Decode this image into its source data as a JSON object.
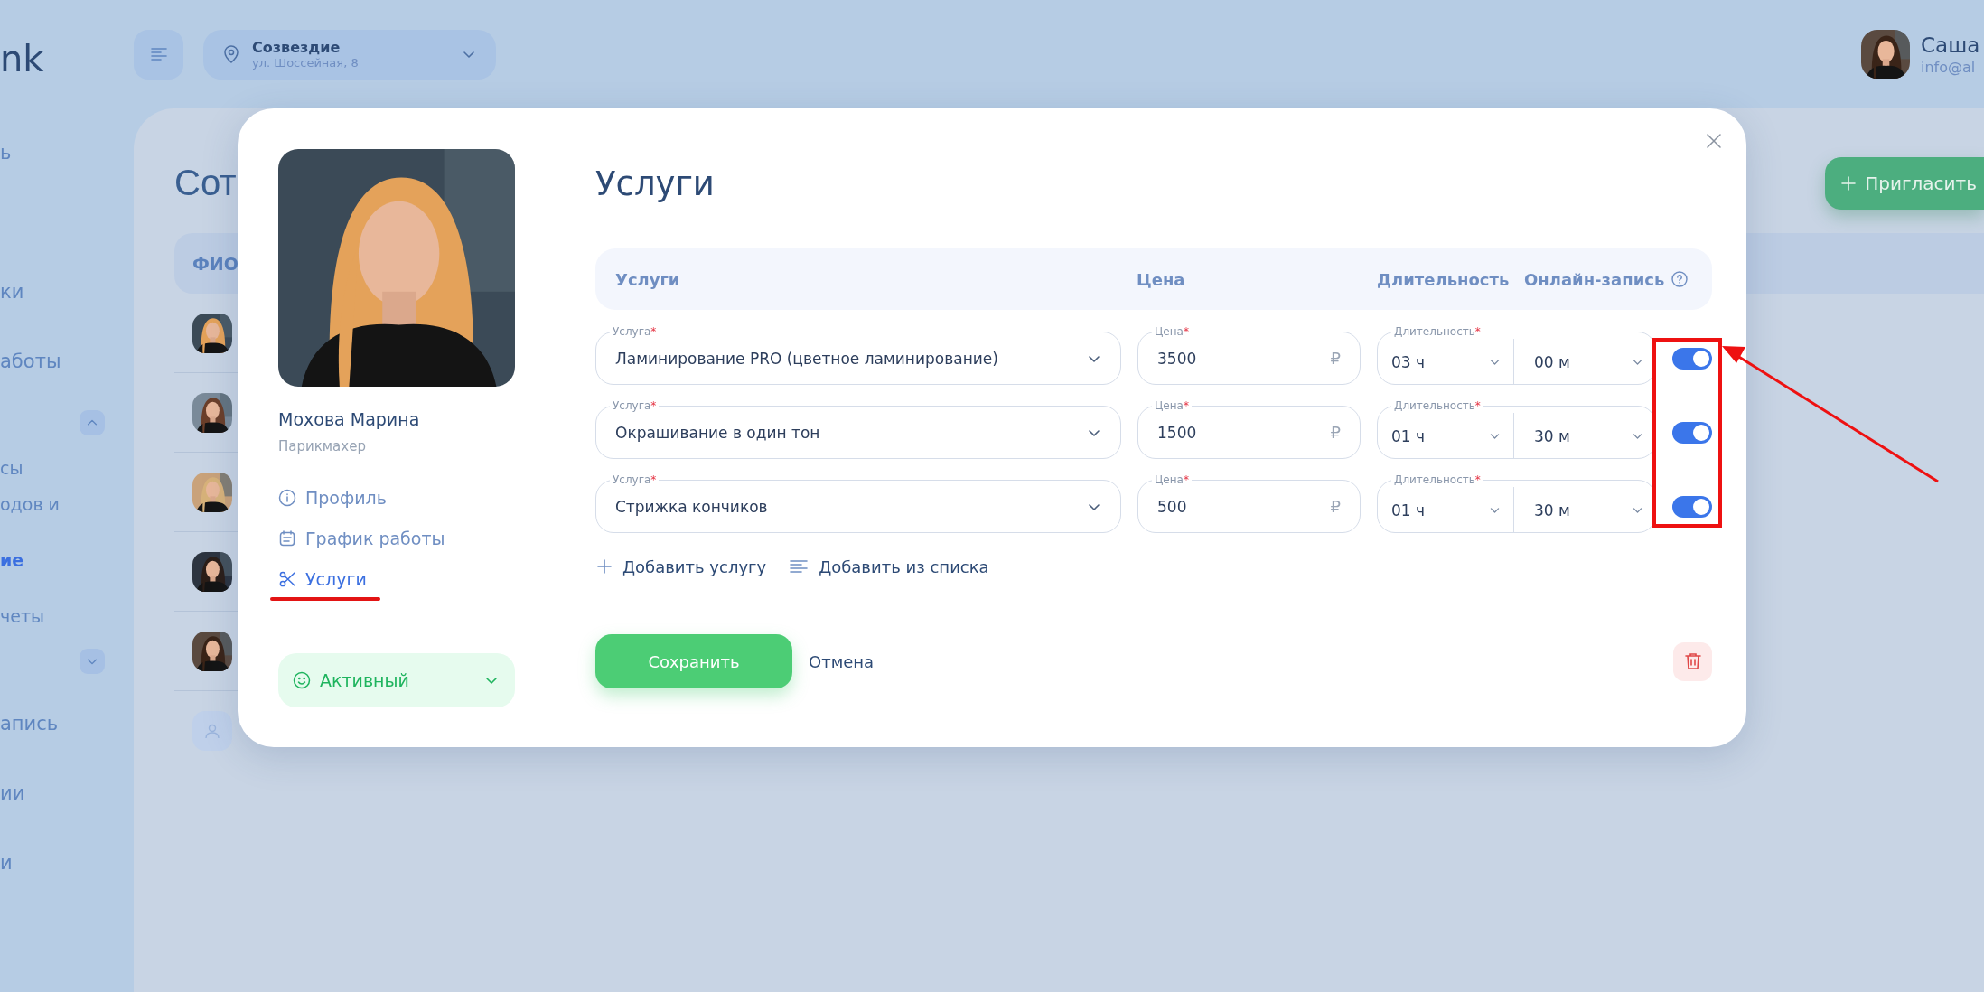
{
  "sidebar": {
    "logo": "nk",
    "items": [
      {
        "kind": "link",
        "label": "ь",
        "selected": false
      },
      {
        "kind": "link",
        "label": "ки",
        "selected": false
      },
      {
        "kind": "link",
        "label": "аботы",
        "selected": false
      },
      {
        "kind": "group",
        "expanded": true
      },
      {
        "kind": "sublink",
        "label": "сы",
        "selected": false
      },
      {
        "kind": "sublink",
        "label": "одов и",
        "selected": false
      },
      {
        "kind": "sublink",
        "label": "ие",
        "selected": true
      },
      {
        "kind": "sublink",
        "label": "четы",
        "selected": false
      },
      {
        "kind": "group",
        "expanded": false
      },
      {
        "kind": "link",
        "label": "апись",
        "selected": false
      },
      {
        "kind": "link",
        "label": "ии",
        "selected": false
      },
      {
        "kind": "link",
        "label": "и",
        "selected": false
      }
    ]
  },
  "header": {
    "location": {
      "name": "Созвездие",
      "address": "ул. Шоссейная, 8"
    },
    "user": {
      "name": "Саша",
      "email": "info@al"
    }
  },
  "page": {
    "title": "Сот",
    "invite_button": "Пригласить",
    "table": {
      "columns": [
        "ФИО"
      ],
      "rows": [
        {
          "kind": "picture"
        },
        {
          "kind": "picture"
        },
        {
          "kind": "picture"
        },
        {
          "kind": "picture"
        },
        {
          "kind": "picture"
        },
        {
          "kind": "placeholder"
        }
      ]
    }
  },
  "modal": {
    "employee": {
      "name": "Мохова Марина",
      "role": "Парикмахер"
    },
    "nav": [
      {
        "kind": "info",
        "label": "Профиль",
        "selected": false
      },
      {
        "kind": "calendar",
        "label": "График работы",
        "selected": false
      },
      {
        "kind": "scissors",
        "label": "Услуги",
        "selected": true
      }
    ],
    "status": {
      "label": "Активный"
    },
    "title": "Услуги",
    "columns": [
      "Услуги",
      "Цена",
      "Длительность",
      "Онлайн-запись"
    ],
    "services": [
      {
        "service": {
          "label": "Услуга",
          "mark": "*",
          "value": "Ламинирование PRO (цветное ламинирование)"
        },
        "price": {
          "label": "Цена",
          "mark": "*",
          "value": "3500",
          "suffix": "₽"
        },
        "duration": {
          "label": "Длительность",
          "mark": "*",
          "hours": "03 ч",
          "minutes": "00 м"
        },
        "online": true
      },
      {
        "service": {
          "label": "Услуга",
          "mark": "*",
          "value": "Окрашивание в один тон"
        },
        "price": {
          "label": "Цена",
          "mark": "*",
          "value": "1500",
          "suffix": "₽"
        },
        "duration": {
          "label": "Длительность",
          "mark": "*",
          "hours": "01 ч",
          "minutes": "30 м"
        },
        "online": true
      },
      {
        "service": {
          "label": "Услуга",
          "mark": "*",
          "value": "Стрижка кончиков"
        },
        "price": {
          "label": "Цена",
          "mark": "*",
          "value": "500",
          "suffix": "₽"
        },
        "duration": {
          "label": "Длительность",
          "mark": "*",
          "hours": "01 ч",
          "minutes": "30 м"
        },
        "online": true
      }
    ],
    "actions": [
      {
        "kind": "add",
        "label": "Добавить услугу"
      },
      {
        "kind": "list",
        "label": "Добавить из списка"
      }
    ],
    "save": "Сохранить",
    "cancel": "Отмена"
  }
}
